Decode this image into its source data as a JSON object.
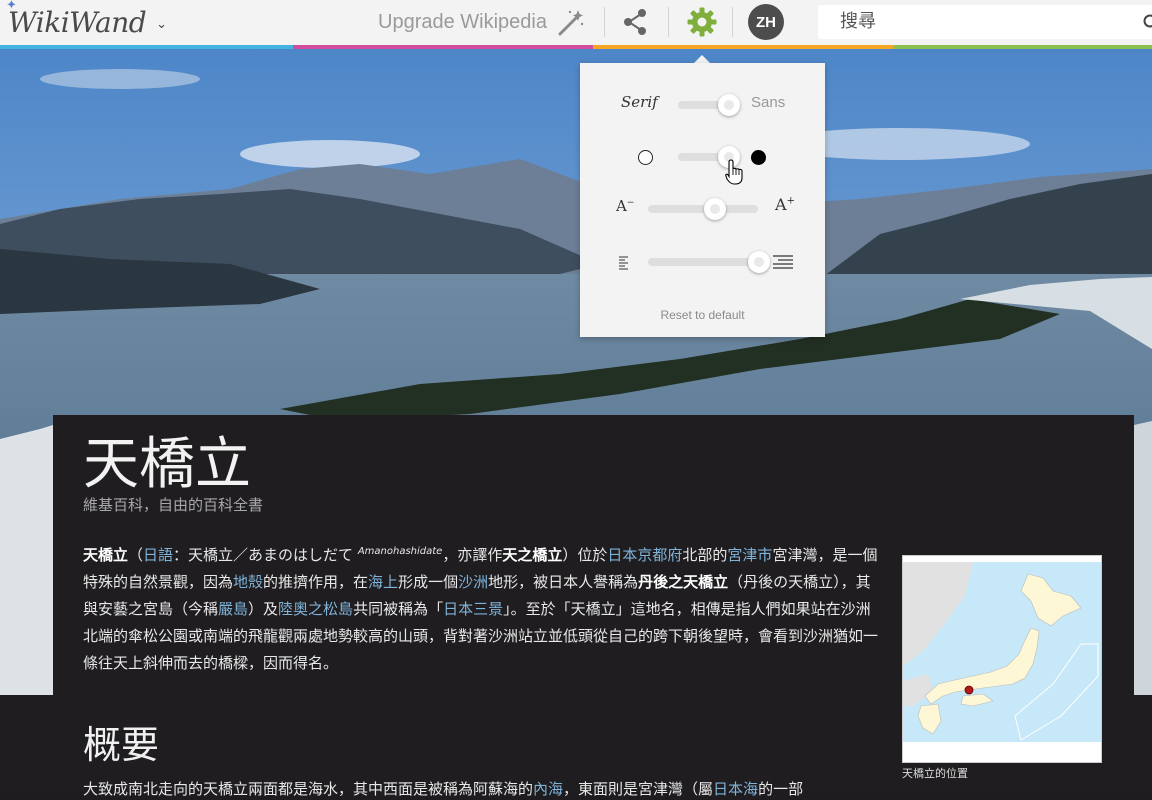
{
  "topbar": {
    "logo_text": "WikiWand",
    "upgrade_label": "Upgrade Wikipedia",
    "language_badge": "ZH",
    "search_placeholder": "搜尋",
    "strip_colors": [
      "#44b3e0",
      "#d14d9c",
      "#f5a623",
      "#8cc152"
    ]
  },
  "settings": {
    "font_serif_label": "Serif",
    "font_sans_label": "Sans",
    "font_style_level": 1.0,
    "theme_level": 1.0,
    "text_size_level": 0.5,
    "line_spacing_level": 1.0,
    "text_size_minus": "A",
    "text_size_plus": "A",
    "reset_label": "Reset to default"
  },
  "article": {
    "title": "天橋立",
    "subtitle": "維基百科，自由的百科全書",
    "lead": {
      "term": "天橋立",
      "p1": "（",
      "link_japanese": "日語",
      "p2": "：天橋立／あまのはしだて ",
      "romaji": "Amanohashidate",
      "p3": "，亦譯作",
      "alt_name": "天之橋立",
      "p4": "）位於",
      "link_kyoto": "日本京都府",
      "p5": "北部的",
      "link_miyazu": "宮津市",
      "p6": "宮津灣，是一個特殊的自然景觀，因為",
      "link_crust": "地殼",
      "p7": "的推擠作用，在",
      "link_sea": "海上",
      "p8": "形成一個",
      "link_sandbar": "沙洲",
      "p9": "地形，被日本人譽稱為",
      "tango_name": "丹後之天橋立",
      "p10": "（丹後の天橋立），其與安藝之宮島（今稱",
      "link_itsukushima": "嚴島",
      "p11": "）及",
      "link_matsushima": "陸奧之松島",
      "p12": "共同被稱為「",
      "link_three_views": "日本三景",
      "p13": "」。至於「天橋立」這地名，相傳是指人們如果站在沙洲北端的傘松公園或南端的飛龍觀兩處地勢較高的山頭，背對著沙洲站立並低頭從自己的跨下朝後望時，會看到沙洲猶如一條往天上斜伸而去的橋樑，因而得名。"
    },
    "section_heading": "概要",
    "next_paragraph": {
      "t1": "大致成南北走向的天橋立兩面都是海水，其中西面是被稱為阿蘇海的",
      "link_inner_sea": "內海",
      "t2": "，東面則是宮津灣（屬",
      "link_sea_of_japan": "日本海",
      "t3": "的一部"
    },
    "map_caption": "天橋立的位置"
  }
}
